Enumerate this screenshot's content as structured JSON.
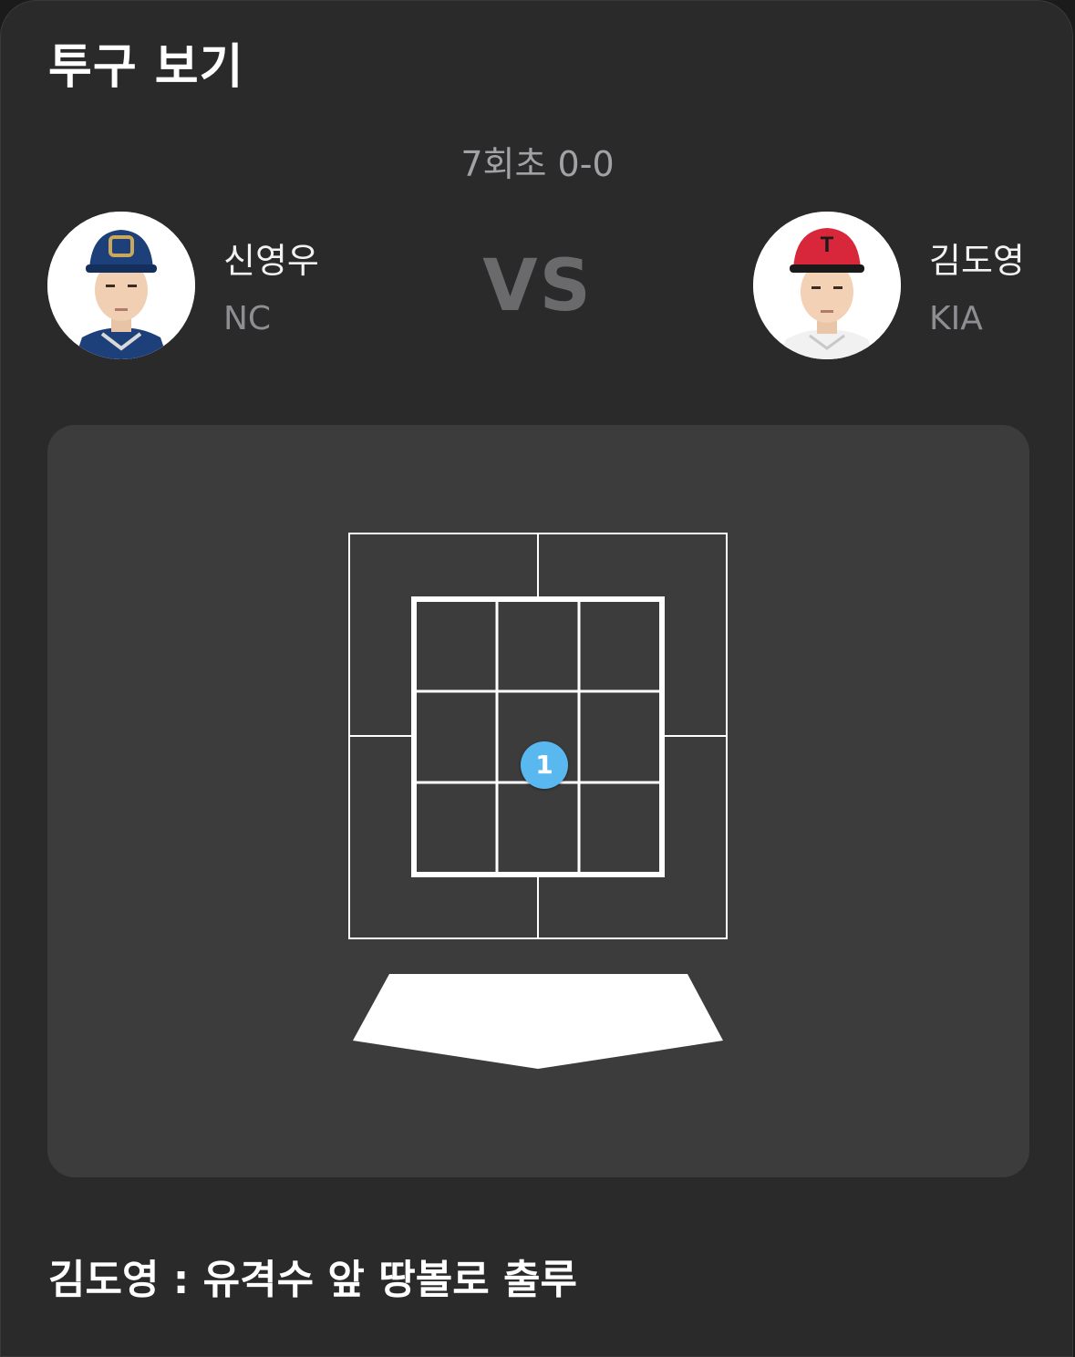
{
  "header": {
    "title": "투구 보기"
  },
  "game": {
    "inning_score": "7회초 0-0",
    "vs_label": "VS"
  },
  "pitcher": {
    "name": "신영우",
    "team": "NC",
    "cap_color": "#1d3f7a",
    "logo_color": "#c9a85a"
  },
  "batter": {
    "name": "김도영",
    "team": "KIA",
    "cap_color": "#d8263a",
    "logo_letter": "T"
  },
  "zone": {
    "pitches": [
      {
        "number": "1",
        "color": "#5ab8f0"
      }
    ]
  },
  "result": {
    "text": "김도영 : 유격수 앞 땅볼로 출루"
  }
}
